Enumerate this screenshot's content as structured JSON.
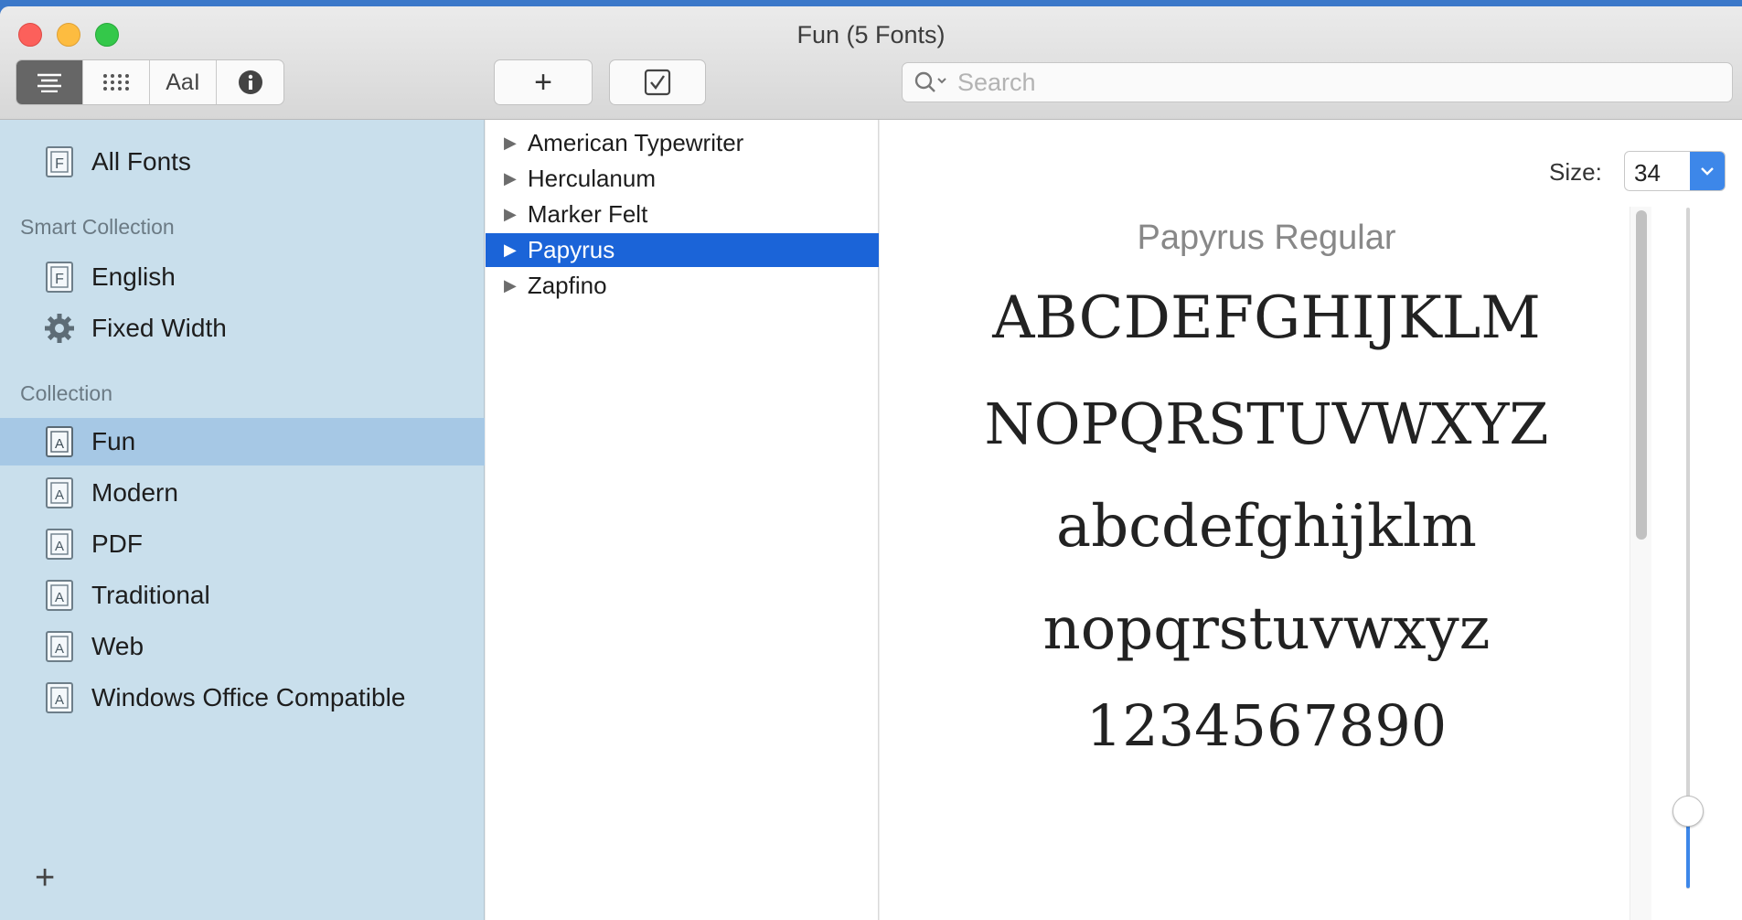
{
  "window": {
    "title": "Fun (5 Fonts)"
  },
  "toolbar": {
    "view_buttons": [
      {
        "name": "list-view",
        "label": ""
      },
      {
        "name": "grid-view",
        "label": ""
      },
      {
        "name": "sample-view",
        "label": "AaI"
      },
      {
        "name": "info-view",
        "label": ""
      }
    ],
    "add_label": "+",
    "search_placeholder": "Search"
  },
  "sidebar": {
    "all_fonts": "All Fonts",
    "smart_collection_header": "Smart Collection",
    "smart_collections": [
      "English",
      "Fixed Width"
    ],
    "collection_header": "Collection",
    "collections": [
      "Fun",
      "Modern",
      "PDF",
      "Traditional",
      "Web",
      "Windows Office Compatible"
    ],
    "selected": "Fun",
    "add_label": "+"
  },
  "font_list": {
    "items": [
      "American Typewriter",
      "Herculanum",
      "Marker Felt",
      "Papyrus",
      "Zapfino"
    ],
    "selected": "Papyrus"
  },
  "preview": {
    "size_label": "Size:",
    "size_value": "34",
    "font_name": "Papyrus Regular",
    "lines": [
      "ABCDEFGHIJKLM",
      "NOPQRSTUVWXYZ",
      "abcdefghijklm",
      "nopqrstuvwxyz",
      "1234567890"
    ]
  },
  "colors": {
    "accent": "#1b64d8",
    "sidebar_bg": "#c9dfec",
    "sidebar_selected": "#a6c8e5"
  }
}
